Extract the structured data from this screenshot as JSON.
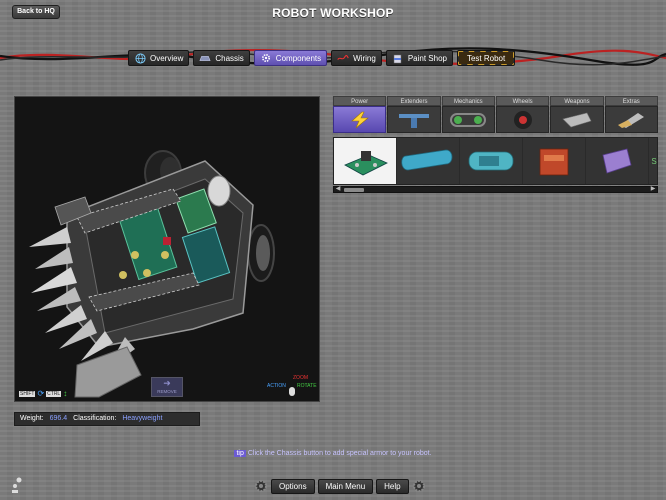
{
  "header": {
    "back_label": "Back to HQ",
    "title": "ROBOT WORKSHOP"
  },
  "tabs": [
    {
      "label": "Overview",
      "icon": "globe-icon",
      "active": false
    },
    {
      "label": "Chassis",
      "icon": "chassis-icon",
      "active": false
    },
    {
      "label": "Components",
      "icon": "gear-icon",
      "active": true
    },
    {
      "label": "Wiring",
      "icon": "wiring-icon",
      "active": false
    },
    {
      "label": "Paint Shop",
      "icon": "paint-can-icon",
      "active": false
    },
    {
      "label": "Test Robot",
      "icon": "",
      "active": false
    }
  ],
  "viewport": {
    "controls": {
      "shift_key": "SHIFT",
      "ctrl_key": "CTRL",
      "remove_label": "REMOVE",
      "zoom_label": "ZOOM",
      "action_label": "ACTION",
      "rotate_label": "ROTATE"
    }
  },
  "stats": {
    "weight_label": "Weight:",
    "weight_value": "696.4",
    "class_label": "Classification:",
    "class_value": "Heavyweight"
  },
  "parts": {
    "categories": [
      {
        "label": "Power",
        "icon": "lightning-icon",
        "active": true
      },
      {
        "label": "Extenders",
        "icon": "extender-icon",
        "active": false
      },
      {
        "label": "Mechanics",
        "icon": "tread-icon",
        "active": false
      },
      {
        "label": "Wheels",
        "icon": "wheel-icon",
        "active": false
      },
      {
        "label": "Weapons",
        "icon": "weapon-icon",
        "active": false
      },
      {
        "label": "Extras",
        "icon": "extras-icon",
        "active": false
      }
    ],
    "items": [
      {
        "icon": "circuit-board-icon",
        "selected": true
      },
      {
        "icon": "motor-cylinder-icon",
        "selected": false
      },
      {
        "icon": "battery-cylinder-icon",
        "selected": false
      },
      {
        "icon": "red-box-icon",
        "selected": false
      },
      {
        "icon": "purple-block-icon",
        "selected": false
      }
    ],
    "partial_item_text": "S"
  },
  "tip": {
    "tag": "tip",
    "text": "Click the Chassis button to add special armor to your robot."
  },
  "bottom": {
    "options_label": "Options",
    "main_menu_label": "Main Menu",
    "help_label": "Help"
  },
  "colors": {
    "accent": "#6c5bd3",
    "background": "#7b7b7b",
    "stat_value": "#8aa0ff"
  }
}
